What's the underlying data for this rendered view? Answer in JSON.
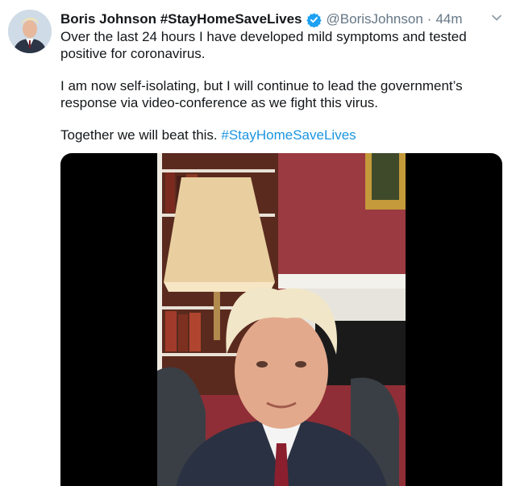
{
  "tweet": {
    "display_name": "Boris Johnson #StayHomeSaveLives",
    "handle": "@BorisJohnson",
    "separator": "·",
    "time": "44m",
    "paragraph_1": "Over the last 24 hours I have developed mild symptoms and tested positive for coronavirus.",
    "paragraph_2": "I am now self-isolating, but I will continue to lead the government’s response via video-conference as we fight this virus.",
    "paragraph_3_text": "Together we will beat this.",
    "paragraph_3_hashtag": "#StayHomeSaveLives"
  },
  "icons": {
    "verified": "verified-badge-icon",
    "caret": "chevron-down-icon"
  },
  "colors": {
    "text": "#14171a",
    "secondary": "#657786",
    "link": "#1b95e0",
    "verified": "#1da1f2"
  }
}
